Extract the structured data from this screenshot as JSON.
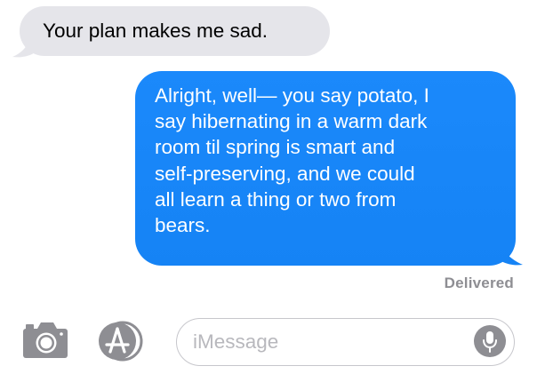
{
  "conversation": {
    "received_message": "Your plan makes me sad.",
    "sent_message_lines": [
      "Alright, well— you say potato, I",
      "say hibernating in a warm dark",
      "room til spring is smart and",
      "self-preserving, and we could",
      "all learn a thing or two from",
      "bears."
    ],
    "status": "Delivered"
  },
  "composer": {
    "placeholder": "iMessage",
    "camera_icon": "camera-icon",
    "apps_icon": "app-store-icon",
    "mic_icon": "microphone-icon"
  },
  "colors": {
    "received_bubble": "#e5e5ea",
    "sent_bubble": "#1a86f8",
    "status_text": "#8e8e93",
    "icon_gray": "#8e8e93"
  }
}
